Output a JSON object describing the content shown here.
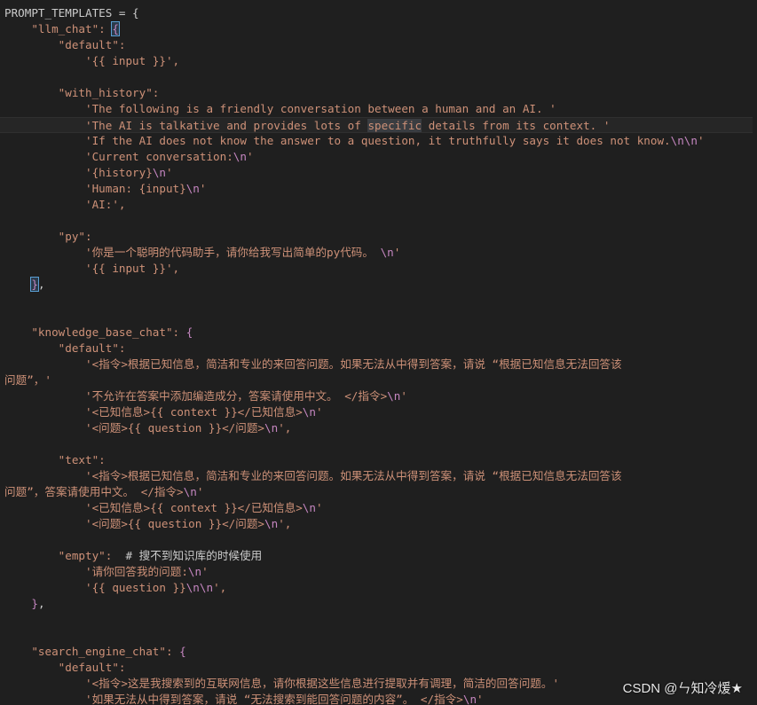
{
  "editor": {
    "lines": [
      {
        "tokens": [
          {
            "t": "PROMPT_TEMPLATES = {",
            "c": "w"
          }
        ]
      },
      {
        "tokens": [
          {
            "t": "    \"llm_chat\": ",
            "c": "s"
          },
          {
            "t": "{",
            "c": "pu",
            "m": "bm"
          }
        ]
      },
      {
        "tokens": [
          {
            "t": "        \"default\":",
            "c": "s"
          }
        ]
      },
      {
        "tokens": [
          {
            "t": "            '{{ input }}',",
            "c": "s"
          }
        ]
      },
      {
        "tokens": [
          {
            "t": "",
            "c": "w"
          }
        ]
      },
      {
        "tokens": [
          {
            "t": "        \"with_history\":",
            "c": "s"
          }
        ]
      },
      {
        "tokens": [
          {
            "t": "            'The following is a friendly conversation between a human and an AI. '",
            "c": "s"
          }
        ]
      },
      {
        "current": true,
        "tokens": [
          {
            "t": "            'The AI is talkative and provides lots of ",
            "c": "s"
          },
          {
            "t": "specific",
            "c": "s",
            "m": "hl"
          },
          {
            "t": " details from its context. '",
            "c": "s"
          }
        ]
      },
      {
        "tokens": [
          {
            "t": "            'If the AI does not know the answer to a question, it truthfully says it does not know.",
            "c": "s"
          },
          {
            "t": "\\n\\n",
            "c": "pu"
          },
          {
            "t": "'",
            "c": "s"
          }
        ]
      },
      {
        "tokens": [
          {
            "t": "            'Current conversation:",
            "c": "s"
          },
          {
            "t": "\\n",
            "c": "pu"
          },
          {
            "t": "'",
            "c": "s"
          }
        ]
      },
      {
        "tokens": [
          {
            "t": "            '{history}",
            "c": "s"
          },
          {
            "t": "\\n",
            "c": "pu"
          },
          {
            "t": "'",
            "c": "s"
          }
        ]
      },
      {
        "tokens": [
          {
            "t": "            'Human: {input}",
            "c": "s"
          },
          {
            "t": "\\n",
            "c": "pu"
          },
          {
            "t": "'",
            "c": "s"
          }
        ]
      },
      {
        "tokens": [
          {
            "t": "            'AI:',",
            "c": "s"
          }
        ]
      },
      {
        "tokens": [
          {
            "t": "",
            "c": "w"
          }
        ]
      },
      {
        "tokens": [
          {
            "t": "        \"py\":",
            "c": "s"
          }
        ]
      },
      {
        "tokens": [
          {
            "t": "            '你是一个聪明的代码助手，请你给我写出简单的py代码。 ",
            "c": "s"
          },
          {
            "t": "\\n",
            "c": "pu"
          },
          {
            "t": "'",
            "c": "s"
          }
        ]
      },
      {
        "tokens": [
          {
            "t": "            '{{ input }}',",
            "c": "s"
          }
        ]
      },
      {
        "tokens": [
          {
            "t": "    ",
            "c": "w"
          },
          {
            "t": "}",
            "c": "pu",
            "m": "bm"
          },
          {
            "t": ",",
            "c": "w"
          }
        ]
      },
      {
        "tokens": [
          {
            "t": "",
            "c": "w"
          }
        ]
      },
      {
        "tokens": [
          {
            "t": "",
            "c": "w"
          }
        ]
      },
      {
        "tokens": [
          {
            "t": "    \"knowledge_base_chat\": ",
            "c": "s"
          },
          {
            "t": "{",
            "c": "pu"
          }
        ]
      },
      {
        "tokens": [
          {
            "t": "        \"default\":",
            "c": "s"
          }
        ]
      },
      {
        "tokens": [
          {
            "t": "            '<指令>根据已知信息，简洁和专业的来回答问题。如果无法从中得到答案，请说 “根据已知信息无法回答该",
            "c": "s"
          }
        ]
      },
      {
        "tokens": [
          {
            "t": "问题”，'",
            "c": "s"
          }
        ]
      },
      {
        "tokens": [
          {
            "t": "            '不允许在答案中添加编造成分，答案请使用中文。 </指令>",
            "c": "s"
          },
          {
            "t": "\\n",
            "c": "pu"
          },
          {
            "t": "'",
            "c": "s"
          }
        ]
      },
      {
        "tokens": [
          {
            "t": "            '<已知信息>{{ context }}</已知信息>",
            "c": "s"
          },
          {
            "t": "\\n",
            "c": "pu"
          },
          {
            "t": "'",
            "c": "s"
          }
        ]
      },
      {
        "tokens": [
          {
            "t": "            '<问题>{{ question }}</问题>",
            "c": "s"
          },
          {
            "t": "\\n",
            "c": "pu"
          },
          {
            "t": "',",
            "c": "s"
          }
        ]
      },
      {
        "tokens": [
          {
            "t": "",
            "c": "w"
          }
        ]
      },
      {
        "tokens": [
          {
            "t": "        \"text\":",
            "c": "s"
          }
        ]
      },
      {
        "tokens": [
          {
            "t": "            '<指令>根据已知信息，简洁和专业的来回答问题。如果无法从中得到答案，请说 “根据已知信息无法回答该",
            "c": "s"
          }
        ]
      },
      {
        "tokens": [
          {
            "t": "问题”，答案请使用中文。 </指令>",
            "c": "s"
          },
          {
            "t": "\\n",
            "c": "pu"
          },
          {
            "t": "'",
            "c": "s"
          }
        ]
      },
      {
        "tokens": [
          {
            "t": "            '<已知信息>{{ context }}</已知信息>",
            "c": "s"
          },
          {
            "t": "\\n",
            "c": "pu"
          },
          {
            "t": "'",
            "c": "s"
          }
        ]
      },
      {
        "tokens": [
          {
            "t": "            '<问题>{{ question }}</问题>",
            "c": "s"
          },
          {
            "t": "\\n",
            "c": "pu"
          },
          {
            "t": "',",
            "c": "s"
          }
        ]
      },
      {
        "tokens": [
          {
            "t": "",
            "c": "w"
          }
        ]
      },
      {
        "tokens": [
          {
            "t": "        \"empty\":",
            "c": "s"
          },
          {
            "t": "  # 搜不到知识库的时候使用",
            "c": "c"
          }
        ]
      },
      {
        "tokens": [
          {
            "t": "            '请你回答我的问题:",
            "c": "s"
          },
          {
            "t": "\\n",
            "c": "pu"
          },
          {
            "t": "'",
            "c": "s"
          }
        ]
      },
      {
        "tokens": [
          {
            "t": "            '{{ question }}",
            "c": "s"
          },
          {
            "t": "\\n\\n",
            "c": "pu"
          },
          {
            "t": "',",
            "c": "s"
          }
        ]
      },
      {
        "tokens": [
          {
            "t": "    ",
            "c": "w"
          },
          {
            "t": "}",
            "c": "pu"
          },
          {
            "t": ",",
            "c": "w"
          }
        ]
      },
      {
        "tokens": [
          {
            "t": "",
            "c": "w"
          }
        ]
      },
      {
        "tokens": [
          {
            "t": "",
            "c": "w"
          }
        ]
      },
      {
        "tokens": [
          {
            "t": "    \"search_engine_chat\": ",
            "c": "s"
          },
          {
            "t": "{",
            "c": "pu"
          }
        ]
      },
      {
        "tokens": [
          {
            "t": "        \"default\":",
            "c": "s"
          }
        ]
      },
      {
        "tokens": [
          {
            "t": "            '<指令>这是我搜索到的互联网信息，请你根据这些信息进行提取并有调理，简洁的回答问题。'",
            "c": "s"
          }
        ]
      },
      {
        "tokens": [
          {
            "t": "            '如果无法从中得到答案，请说 “无法搜索到能回答问题的内容”。 </指令>",
            "c": "s"
          },
          {
            "t": "\\n",
            "c": "pu"
          },
          {
            "t": "'",
            "c": "s"
          }
        ]
      }
    ]
  },
  "watermark": {
    "text": "CSDN @ㄣ知冷煖★"
  },
  "colors": {
    "background": "#1f1f1f",
    "default_text": "#cccccc",
    "string": "#ce9178",
    "escape": "#c586c0",
    "highlight": "#3a3d41",
    "bracket_match": "#5a9fd4"
  }
}
